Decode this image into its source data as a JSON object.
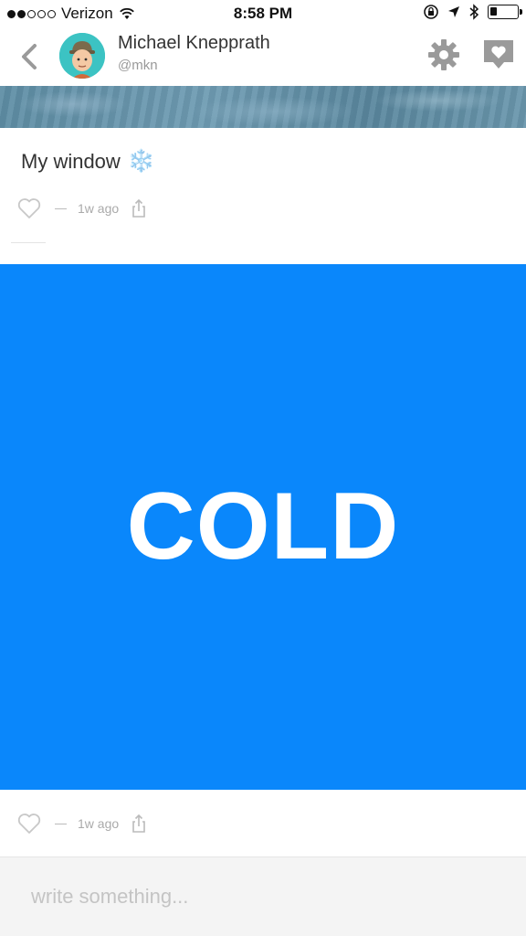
{
  "status_bar": {
    "carrier": "Verizon",
    "signal_bars": 2,
    "signal_total": 5,
    "time": "8:58 PM",
    "battery_level": 0.25
  },
  "header": {
    "name": "Michael Knepprath",
    "handle": "@mkn",
    "icons": [
      "back-chevron-icon",
      "avatar",
      "gear-icon",
      "heart-bubble-icon"
    ]
  },
  "posts": [
    {
      "text": "My window",
      "emoji": "❄️",
      "time": "1w ago"
    },
    {
      "image_text": "COLD",
      "image_color": "#0a87fb",
      "time": "1w ago"
    }
  ],
  "compose": {
    "placeholder": "write something..."
  },
  "colors": {
    "accent_blue": "#0a87fb",
    "icon_gray": "#9a9a9a",
    "avatar_teal": "#3cc3c3"
  }
}
